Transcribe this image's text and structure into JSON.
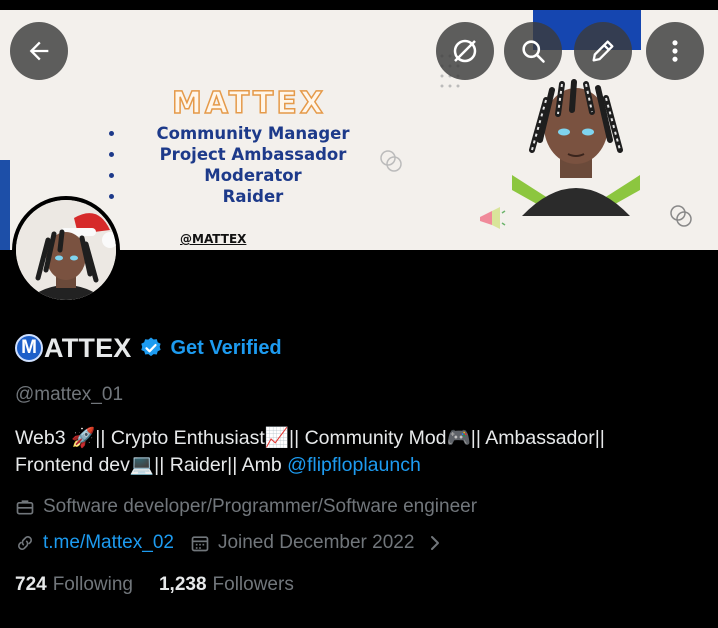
{
  "banner": {
    "brand": "MATTEX",
    "roles": [
      "Community Manager",
      "Project Ambassador",
      "Moderator",
      "Raider"
    ],
    "handle": "@MATTEX"
  },
  "header": {
    "back_icon": "arrow-left-icon",
    "buttons": [
      "eye-off-icon",
      "search-icon",
      "edit-icon",
      "more-vertical-icon"
    ]
  },
  "profile": {
    "name": "ATTEX",
    "name_badge": "M",
    "get_verified": "Get Verified",
    "handle": "@mattex_01",
    "bio_line1": "Web3 🚀||  Crypto Enthusiast📈||  Community Mod🎮|| Ambassador||",
    "bio_line2": "Frontend dev💻|| Raider|| Amb ",
    "bio_mention": "@flipfloplaunch",
    "profession": "Software developer/Programmer/Software engineer",
    "link": "t.me/Mattex_02",
    "joined": "Joined December 2022",
    "following_count": "724",
    "following_label": "Following",
    "followers_count": "1,238",
    "followers_label": "Followers"
  },
  "colors": {
    "accent": "#1d9bf0",
    "muted": "#71767b",
    "text": "#e7e9ea",
    "background": "#000000"
  }
}
